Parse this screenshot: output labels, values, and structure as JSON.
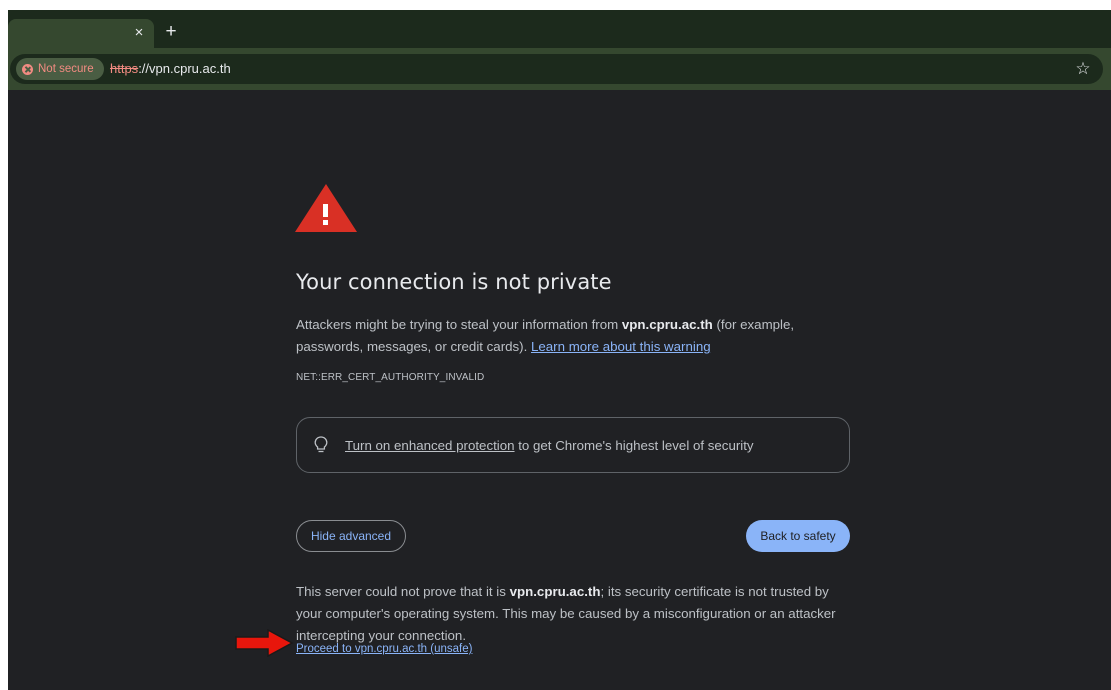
{
  "browser": {
    "tab_close_glyph": "×",
    "new_tab_glyph": "+",
    "security_chip_label": "Not secure",
    "url_scheme": "https",
    "url_rest": "://vpn.cpru.ac.th",
    "bookmark_glyph": "☆"
  },
  "page": {
    "heading": "Your connection is not private",
    "para1_prefix": "Attackers might be trying to steal your information from ",
    "para1_domain": "vpn.cpru.ac.th",
    "para1_suffix": " (for example, passwords, messages, or credit cards). ",
    "learn_more_link": "Learn more about this warning",
    "error_code": "NET::ERR_CERT_AUTHORITY_INVALID",
    "enhanced_link": "Turn on enhanced protection",
    "enhanced_suffix": " to get Chrome's highest level of security",
    "hide_advanced_button": "Hide advanced",
    "back_to_safety_button": "Back to safety",
    "para2_prefix": "This server could not prove that it is ",
    "para2_domain": "vpn.cpru.ac.th",
    "para2_suffix": "; its security certificate is not trusted by your computer's operating system. This may be caused by a misconfiguration or an attacker intercepting your connection.",
    "proceed_link": "Proceed to vpn.cpru.ac.th (unsafe)"
  },
  "colors": {
    "background": "#202124",
    "link": "#8ab4f8",
    "warning_red": "#d93025",
    "annotation_arrow": "#e8160c"
  }
}
